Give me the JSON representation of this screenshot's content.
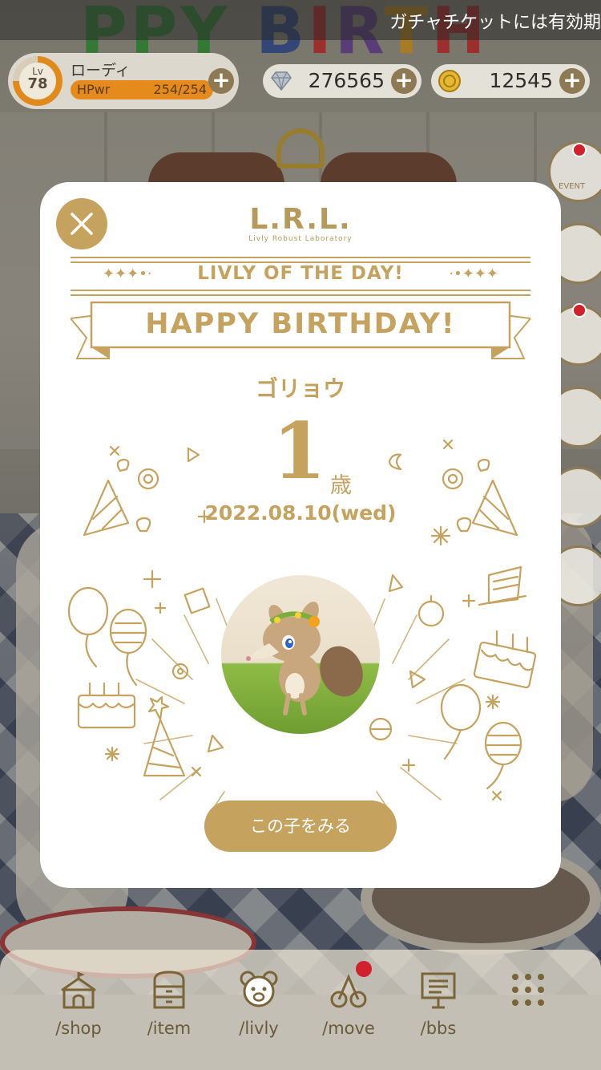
{
  "header": {
    "ticker_text": "ガチャチケットには有効期",
    "user": {
      "lv_label": "Lv",
      "level": "78",
      "name": "ローディ",
      "hp_label": "HPwr",
      "hp_value": "254/254",
      "level_progress": 0.75
    },
    "currency": {
      "gems": "276565",
      "coins": "12545"
    },
    "plus_label": "+"
  },
  "side_menu": {
    "event_label": "EVENT"
  },
  "modal": {
    "logo": "L.R.L.",
    "logo_sub": "Livly Robust Laboratory",
    "day_title": "LIVLY OF THE DAY!",
    "sparkles_left": "✦✦✦•·",
    "sparkles_right": "·•✦✦✦",
    "headline": "HAPPY BIRTHDAY!",
    "pet_name": "ゴリョウ",
    "age": "1",
    "age_unit": "歳",
    "birthday": "2022.08.10(wed)",
    "view_button": "この子をみる"
  },
  "bottom_nav": [
    {
      "label": "/shop",
      "icon": "tent-icon"
    },
    {
      "label": "/item",
      "icon": "drawer-icon"
    },
    {
      "label": "/livly",
      "icon": "bear-face-icon"
    },
    {
      "label": "/move",
      "icon": "move-icon",
      "badge": true
    },
    {
      "label": "/bbs",
      "icon": "board-icon"
    },
    {
      "label": "",
      "icon": "grid-menu-icon"
    }
  ],
  "colors": {
    "gold": "#c5a35f",
    "badge": "#d0212d",
    "hp": "#e58b1d"
  }
}
